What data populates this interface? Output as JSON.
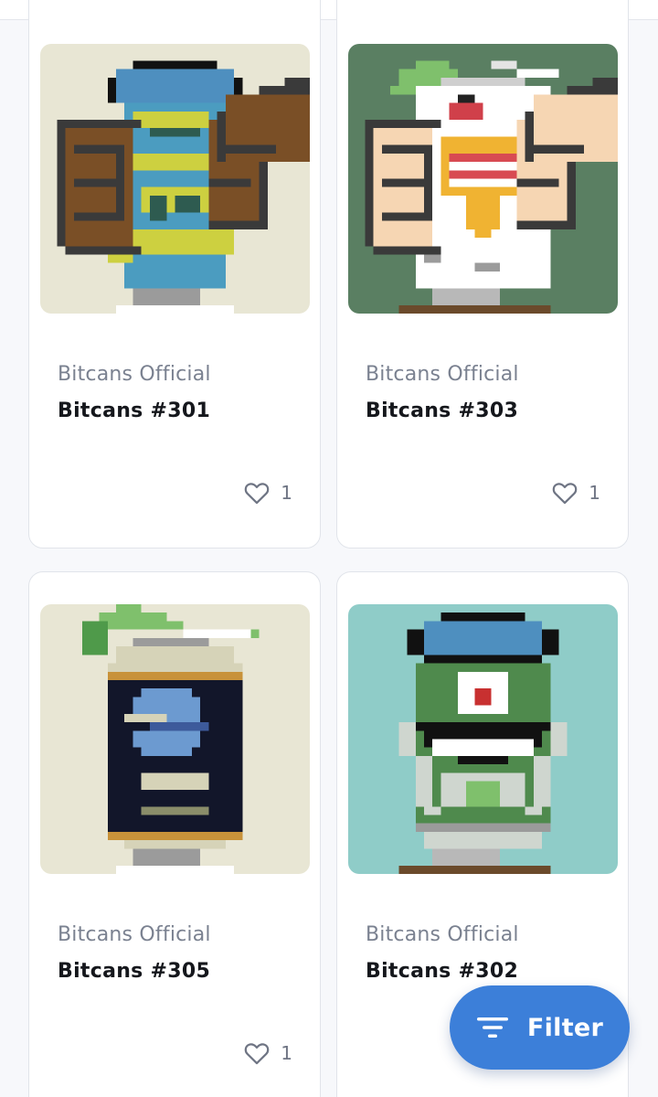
{
  "items": [
    {
      "collection": "Bitcans Official",
      "name": "Bitcans #301",
      "likes": "1",
      "art": "can-301-blue-helmet-brown-fists-icon"
    },
    {
      "collection": "Bitcans Official",
      "name": "Bitcans #303",
      "likes": "1",
      "art": "can-303-white-skull-peach-fists-icon"
    },
    {
      "collection": "Bitcans Official",
      "name": "Bitcans #305",
      "likes": "1",
      "art": "can-305-navy-label-green-lid-icon"
    },
    {
      "collection": "Bitcans Official",
      "name": "Bitcans #302",
      "likes": "",
      "art": "can-302-green-robot-blue-helmet-icon"
    }
  ],
  "filter": {
    "label": "Filter",
    "icon": "filter-lines-icon"
  },
  "icons": {
    "like": "heart-outline-icon"
  },
  "colors": {
    "accent": "#3c7fd9",
    "card_border": "#e1e4ea",
    "muted_text": "#7a8190",
    "title_text": "#15171c"
  }
}
